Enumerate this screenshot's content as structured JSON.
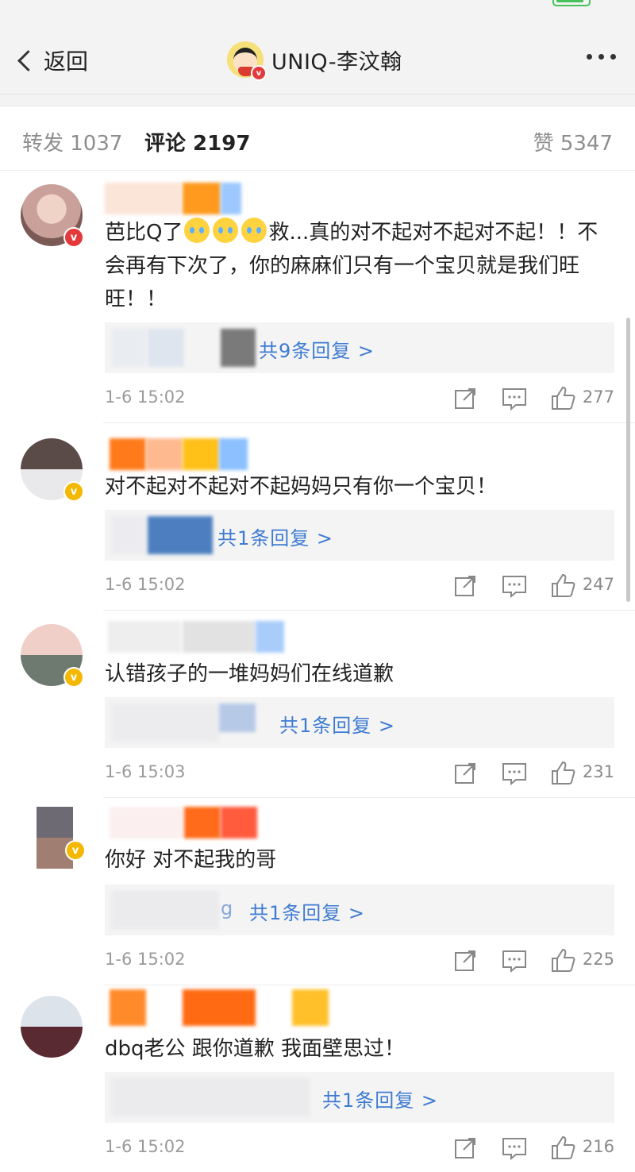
{
  "nav": {
    "back_label": "返回",
    "title": "UNIQ-李汶翰"
  },
  "tabs": [
    {
      "label": "转发 1037"
    },
    {
      "label": "评论 2197"
    },
    {
      "label": "赞 5347"
    }
  ],
  "colors": {
    "link": "#3e7bd2",
    "verified_red": "#e4393c",
    "verified_gold": "#f5b800"
  },
  "icons": {
    "repost": "share-icon",
    "comment": "comment-icon",
    "like": "thumbs-up-icon"
  },
  "comments": [
    {
      "text_a": "芭比Q了",
      "text_b": "救...真的对不起对不起对不起！！不会再有下次了，你的麻麻们只有一个宝贝就是我们旺旺！！",
      "reply": "共9条回复 >",
      "date": "1-6 15:02",
      "likes": "277"
    },
    {
      "text": "对不起对不起对不起妈妈只有你一个宝贝！",
      "reply": "共1条回复 >",
      "date": "1-6 15:02",
      "likes": "247"
    },
    {
      "text": "认错孩子的一堆妈妈们在线道歉",
      "reply": "共1条回复 >",
      "date": "1-6 15:03",
      "likes": "231"
    },
    {
      "text": "你好 对不起我的哥",
      "reply_prefix": "g",
      "reply": "共1条回复 >",
      "date": "1-6 15:02",
      "likes": "225"
    },
    {
      "text": "dbq老公 跟你道歉 我面壁思过！",
      "reply": "共1条回复 >",
      "date": "1-6 15:02",
      "likes": "216"
    }
  ]
}
